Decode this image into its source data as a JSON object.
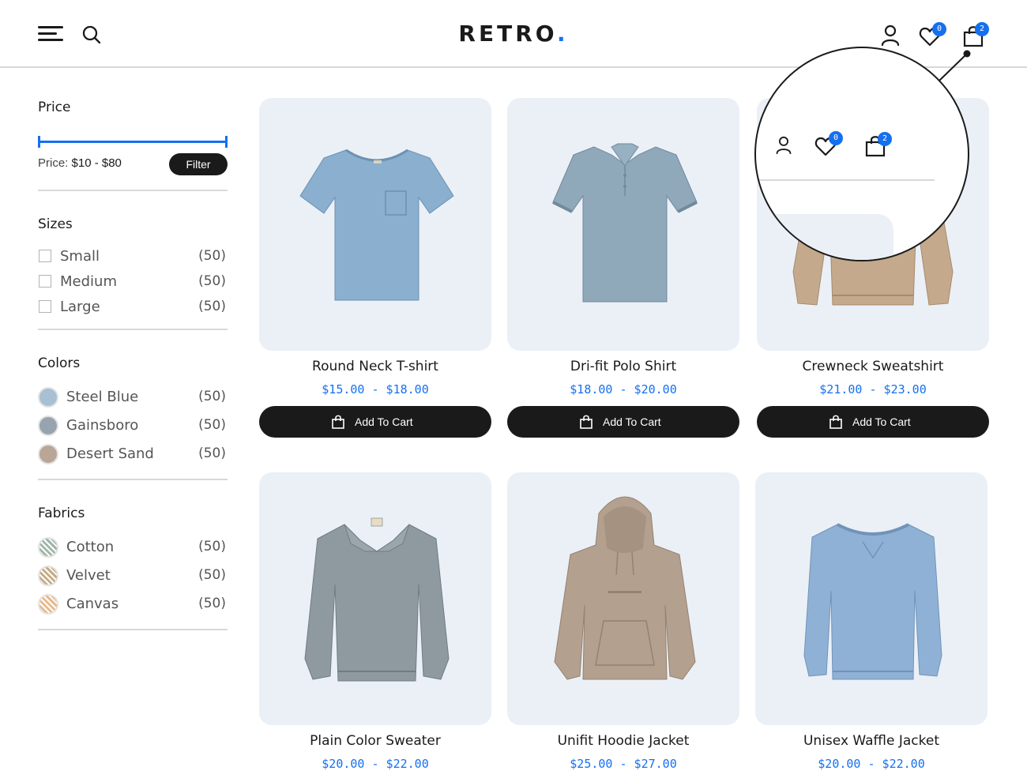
{
  "brand": {
    "name": "RETRO",
    "dot": ".",
    "accent": "#1570ef"
  },
  "header": {
    "menu_icon": "hamburger-menu-icon",
    "search_icon": "search-icon",
    "account_icon": "user-icon",
    "wishlist_icon": "heart-icon",
    "wishlist_count": "0",
    "cart_icon": "shopping-bag-icon",
    "cart_count": "2"
  },
  "filters": {
    "price": {
      "title": "Price",
      "label": "Price:",
      "range": "$10 - $80",
      "min_fraction": 0.0,
      "max_fraction": 1.0,
      "button": "Filter"
    },
    "sizes": {
      "title": "Sizes",
      "items": [
        {
          "label": "Small",
          "count": "(50)"
        },
        {
          "label": "Medium",
          "count": "(50)"
        },
        {
          "label": "Large",
          "count": "(50)"
        }
      ]
    },
    "colors": {
      "title": "Colors",
      "items": [
        {
          "label": "Steel Blue",
          "count": "(50)",
          "color": "#a7c0d4"
        },
        {
          "label": "Gainsboro",
          "count": "(50)",
          "color": "#97a4b0"
        },
        {
          "label": "Desert Sand",
          "count": "(50)",
          "color": "#b9a697"
        }
      ]
    },
    "fabrics": {
      "title": "Fabrics",
      "items": [
        {
          "label": "Cotton",
          "count": "(50)",
          "color": "#9fb5a8"
        },
        {
          "label": "Velvet",
          "count": "(50)",
          "color": "#c7ab82"
        },
        {
          "label": "Canvas",
          "count": "(50)",
          "color": "#e8b98c"
        }
      ]
    }
  },
  "cart_button_label": "Add To Cart",
  "products": [
    {
      "name": "Round Neck T-shirt",
      "price": "$15.00 - $18.00",
      "garment": "tshirt",
      "color": "#8aafcf"
    },
    {
      "name": "Dri-fit Polo Shirt",
      "price": "$18.00 - $20.00",
      "garment": "polo",
      "color": "#8fa8ba"
    },
    {
      "name": "Crewneck Sweatshirt",
      "price": "$21.00 - $23.00",
      "garment": "sweatshirt",
      "color": "#c5a98c"
    },
    {
      "name": "Plain Color Sweater",
      "price": "$20.00 - $22.00",
      "garment": "sweater",
      "color": "#8f9aa0"
    },
    {
      "name": "Unifit Hoodie Jacket",
      "price": "$25.00 - $27.00",
      "garment": "hoodie",
      "color": "#b3a08e"
    },
    {
      "name": "Unisex Waffle Jacket",
      "price": "$20.00 - $22.00",
      "garment": "waffle",
      "color": "#8fb1d6"
    }
  ],
  "magnifier": {
    "account_icon": "user-icon",
    "wishlist_icon": "heart-icon",
    "wishlist_count": "0",
    "cart_icon": "shopping-bag-icon",
    "cart_count": "2"
  }
}
